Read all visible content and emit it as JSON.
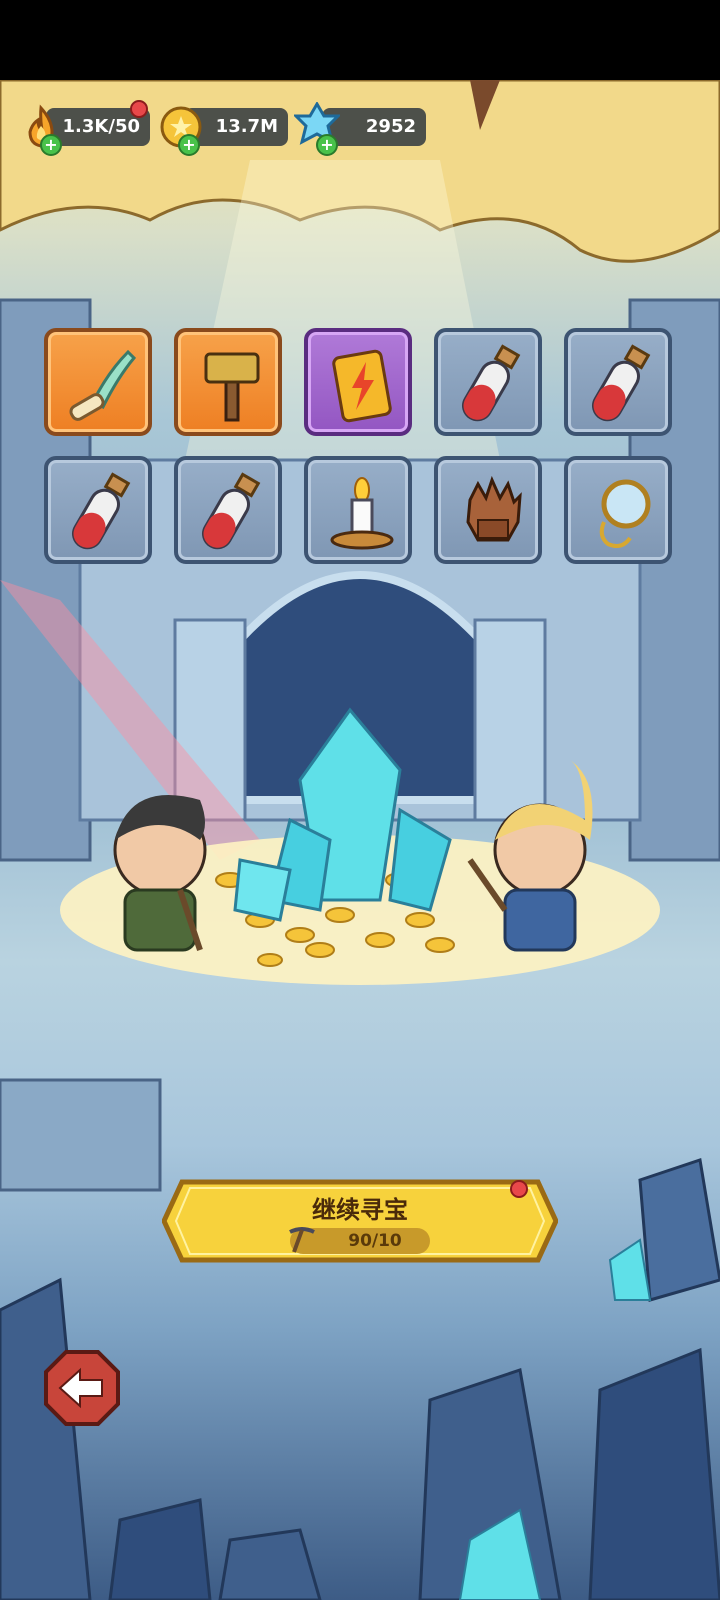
{
  "resources": {
    "energy": {
      "icon": "flame-icon",
      "value": "1.3K/50"
    },
    "gold": {
      "icon": "gold-coin-icon",
      "value": "13.7M"
    },
    "gems": {
      "icon": "crystal-gem-icon",
      "value": "2952"
    }
  },
  "inventory": {
    "slots": [
      {
        "item": "feather-quill-icon",
        "rarity": "orange"
      },
      {
        "item": "war-hammer-icon",
        "rarity": "orange"
      },
      {
        "item": "lightning-spell-card-icon",
        "rarity": "purple"
      },
      {
        "item": "red-potion-icon",
        "rarity": "blue"
      },
      {
        "item": "red-potion-icon",
        "rarity": "blue"
      },
      {
        "item": "red-potion-icon",
        "rarity": "blue"
      },
      {
        "item": "red-potion-icon",
        "rarity": "blue"
      },
      {
        "item": "candle-holder-icon",
        "rarity": "blue"
      },
      {
        "item": "leather-glove-icon",
        "rarity": "blue"
      },
      {
        "item": "pocket-mirror-icon",
        "rarity": "blue"
      }
    ]
  },
  "action": {
    "continue_label": "继续寻宝",
    "pickaxe_count": "90/10"
  },
  "colors": {
    "button_gold": "#f7d23c",
    "orange_rarity": "#f08a2a",
    "purple_rarity": "#a066cf",
    "blue_rarity": "#8aa3bf",
    "back_button": "#c8453a"
  }
}
